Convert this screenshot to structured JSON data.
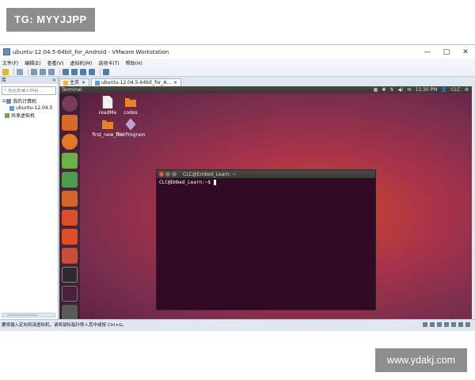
{
  "watermark_top": "TG: MYYJJPP",
  "watermark_bottom": "www.ydakj.com",
  "window": {
    "title": "ubuntu-12.04.5-64bit_for_Android - VMware Workstation",
    "controls": [
      "—",
      "□",
      "✕"
    ]
  },
  "menu": [
    "文件(F)",
    "编辑(E)",
    "查看(V)",
    "虚拟机(M)",
    "选项卡(T)",
    "帮助(H)"
  ],
  "library": {
    "title": "库",
    "close": "×",
    "search_placeholder": "在此处键入内容...",
    "tree": [
      "我的计算机",
      "ubuntu-12.04.5",
      "共享虚拟机"
    ]
  },
  "tabs": [
    {
      "label": "主页",
      "close": "×"
    },
    {
      "label": "ubuntu-12.04.5-64bit_for_A...",
      "close": "×"
    }
  ],
  "guest": {
    "topbar_app": "Terminal",
    "tray": {
      "time": "11:30 PM",
      "user": "CLC"
    },
    "desktop_icons": [
      {
        "label": "readMe",
        "icon": "document-icon"
      },
      {
        "label": "codes",
        "icon": "folder-icon"
      },
      {
        "label": "first_new_file",
        "icon": "folder-icon"
      },
      {
        "label": "firstProgram",
        "icon": "diamond-app-icon"
      }
    ],
    "terminal": {
      "title": "CLC@Embed_Learn: ~",
      "prompt": "CLC@Embed_Learn:~$"
    }
  },
  "status_bar": {
    "hint": "要将输入定向到该虚拟机，请将鼠标指针移入其中或按 Ctrl+G。"
  },
  "colors": {
    "terminal_bg": "#300a24",
    "launcher_bg": "#2a1f2a",
    "wallpaper": "#a8324a"
  }
}
